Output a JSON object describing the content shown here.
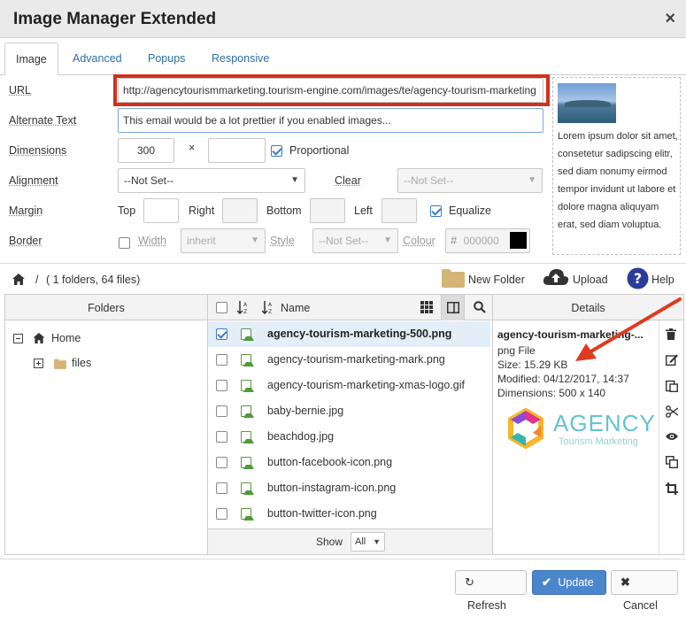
{
  "dialog": {
    "title": "Image Manager Extended",
    "close": "×"
  },
  "tabs": [
    "Image",
    "Advanced",
    "Popups",
    "Responsive"
  ],
  "form": {
    "url_label": "URL",
    "url_value": "http://agencytourismmarketing.tourism-engine.com/images/te/agency-tourism-marketing",
    "alt_label": "Alternate Text",
    "alt_value": "This email would be a lot prettier if you enabled images...",
    "dimensions_label": "Dimensions",
    "width_value": "300",
    "height_value": "",
    "times": "×",
    "proportional_label": "Proportional",
    "alignment_label": "Alignment",
    "alignment_value": "--Not Set--",
    "clear_label": "Clear",
    "clear_value": "--Not Set--",
    "margin_label": "Margin",
    "top_label": "Top",
    "right_label": "Right",
    "bottom_label": "Bottom",
    "left_label": "Left",
    "equalize_label": "Equalize",
    "border_label": "Border",
    "bwidth_label": "Width",
    "bwidth_value": "inherit",
    "style_label": "Style",
    "style_value": "--Not Set--",
    "colour_label": "Colour",
    "colour_hash": "#",
    "colour_value": "000000",
    "colour_swatch": "#000000"
  },
  "preview": {
    "text": "Lorem ipsum dolor sit amet, consetetur sadipscing elitr, sed diam nonumy eirmod tempor invidunt ut labore et dolore magna aliquyam erat, sed diam voluptua."
  },
  "browser": {
    "path": "/",
    "count": "( 1 folders, 64 files)",
    "new_folder": "New Folder",
    "upload": "Upload",
    "help": "Help",
    "folders_header": "Folders",
    "name_header": "Name",
    "details_header": "Details",
    "tree": {
      "home": "Home",
      "files": "files"
    },
    "files": [
      "agency-tourism-marketing-500.png",
      "agency-tourism-marketing-mark.png",
      "agency-tourism-marketing-xmas-logo.gif",
      "baby-bernie.jpg",
      "beachdog.jpg",
      "button-facebook-icon.png",
      "button-instagram-icon.png",
      "button-twitter-icon.png"
    ],
    "show_label": "Show",
    "show_value": "All"
  },
  "details": {
    "name": "agency-tourism-marketing-...",
    "type": "png File",
    "size": "Size: 15.29 KB",
    "modified": "Modified: 04/12/2017, 14:37",
    "dimensions": "Dimensions: 500 x 140",
    "logo_main": "AGENCY",
    "logo_sub": "Tourism Marketing"
  },
  "footer": {
    "refresh": "Refresh",
    "update": "Update",
    "cancel": "Cancel"
  },
  "colors": {
    "accent": "#4a86cc",
    "highlight": "#d0311b",
    "arrow": "#e03a1e"
  }
}
